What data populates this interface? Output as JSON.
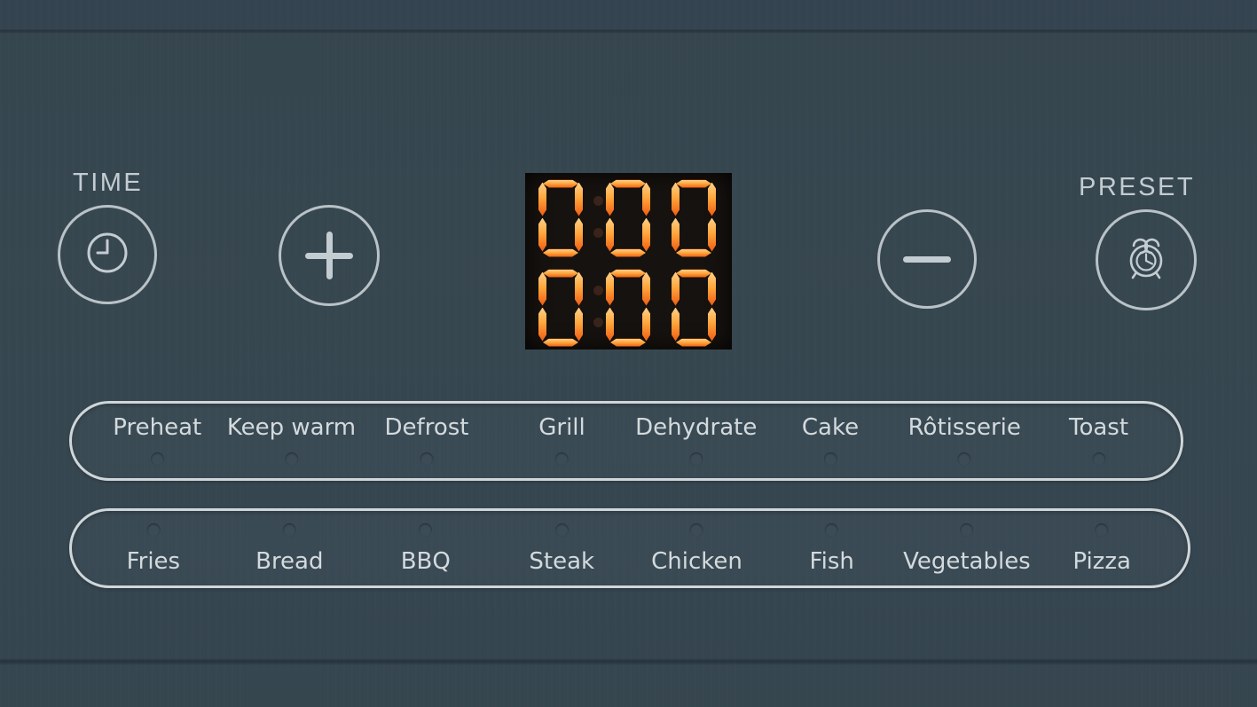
{
  "device": {
    "surface_color": "#36464f",
    "outline_color": "#cfd6d9",
    "text_color": "#d3dadd"
  },
  "controls": {
    "time": {
      "caption": "TIME",
      "icon": "clock-icon"
    },
    "increase": {
      "caption": "",
      "icon": "plus-icon"
    },
    "decrease": {
      "caption": "",
      "icon": "minus-icon"
    },
    "preset": {
      "caption": "PRESET",
      "icon": "alarm-clock-icon"
    }
  },
  "display": {
    "panel_color": "#16120f",
    "segment_color": "#ffa63c",
    "segment_glow_color": "#ef5a12",
    "colon_color": "#3a231a",
    "rows": [
      {
        "name": "temperature",
        "digits": [
          "0",
          "0",
          "0"
        ],
        "colon_lit": false
      },
      {
        "name": "time",
        "digits": [
          "0",
          "0",
          "0"
        ],
        "colon_lit": false
      }
    ]
  },
  "function_rows": [
    {
      "name": "row-1",
      "led_position": "below",
      "items": [
        {
          "label": "Preheat",
          "led_on": false,
          "x_pct": 7.7
        },
        {
          "label": "Keep warm",
          "led_on": false,
          "x_pct": 19.8
        },
        {
          "label": "Defrost",
          "led_on": false,
          "x_pct": 32.0
        },
        {
          "label": "Grill",
          "led_on": false,
          "x_pct": 44.2
        },
        {
          "label": "Dehydrate",
          "led_on": false,
          "x_pct": 56.3
        },
        {
          "label": "Cake",
          "led_on": false,
          "x_pct": 68.4
        },
        {
          "label": "Rôtisserie",
          "led_on": false,
          "x_pct": 80.5
        },
        {
          "label": "Toast",
          "led_on": false,
          "x_pct": 92.6
        }
      ]
    },
    {
      "name": "row-2",
      "led_position": "above",
      "items": [
        {
          "label": "Fries",
          "led_on": false,
          "x_pct": 7.3
        },
        {
          "label": "Bread",
          "led_on": false,
          "x_pct": 19.5
        },
        {
          "label": "BBQ",
          "led_on": false,
          "x_pct": 31.7
        },
        {
          "label": "Steak",
          "led_on": false,
          "x_pct": 43.9
        },
        {
          "label": "Chicken",
          "led_on": false,
          "x_pct": 56.0
        },
        {
          "label": "Fish",
          "led_on": false,
          "x_pct": 68.1
        },
        {
          "label": "Vegetables",
          "led_on": false,
          "x_pct": 80.2
        },
        {
          "label": "Pizza",
          "led_on": false,
          "x_pct": 92.3
        }
      ]
    }
  ]
}
